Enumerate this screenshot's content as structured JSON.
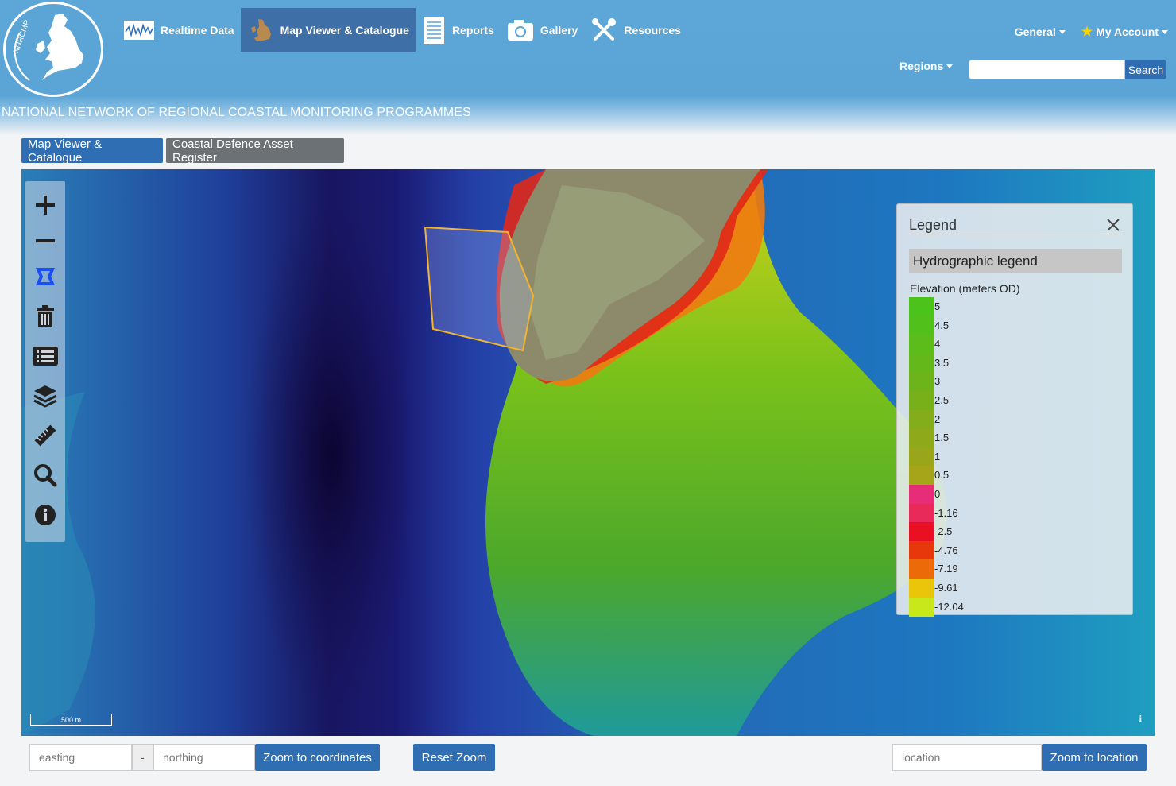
{
  "header": {
    "logo_text": "NNRCMP",
    "nav": [
      {
        "label": "Realtime Data",
        "icon": "waveform-icon"
      },
      {
        "label": "Map Viewer & Catalogue",
        "icon": "uk-map-icon",
        "active": true
      },
      {
        "label": "Reports",
        "icon": "document-icon"
      },
      {
        "label": "Gallery",
        "icon": "camera-icon"
      },
      {
        "label": "Resources",
        "icon": "tools-icon"
      }
    ],
    "general_label": "General",
    "account_label": "My Account",
    "regions_label": "Regions",
    "search_placeholder": "",
    "search_button": "Search",
    "tagline": "NATIONAL NETWORK OF REGIONAL COASTAL MONITORING PROGRAMMES"
  },
  "subtabs": {
    "map_viewer": "Map Viewer & Catalogue",
    "asset_register": "Coastal Defence Asset Register"
  },
  "map": {
    "tools": [
      "zoom-in-icon",
      "zoom-out-icon",
      "draw-polygon-icon",
      "trash-icon",
      "list-icon",
      "layers-icon",
      "ruler-icon",
      "search-zoom-icon",
      "info-icon"
    ],
    "scale_label": "500 m",
    "info_mark": "i"
  },
  "legend": {
    "title": "Legend",
    "subtitle": "Hydrographic legend",
    "units_label": "Elevation (meters OD)",
    "entries": [
      {
        "label": "5",
        "color": "#4cc31a"
      },
      {
        "label": "4.5",
        "color": "#52c01a"
      },
      {
        "label": "4",
        "color": "#5bbc1a"
      },
      {
        "label": "3.5",
        "color": "#64b81a"
      },
      {
        "label": "3",
        "color": "#6db41a"
      },
      {
        "label": "2.5",
        "color": "#78b01a"
      },
      {
        "label": "2",
        "color": "#83ad1a"
      },
      {
        "label": "1.5",
        "color": "#8ea91a"
      },
      {
        "label": "1",
        "color": "#9aa61a"
      },
      {
        "label": "0.5",
        "color": "#a6a51a"
      },
      {
        "label": "0",
        "color": "#e62e78"
      },
      {
        "label": "-1.16",
        "color": "#e82a5a"
      },
      {
        "label": "-2.5",
        "color": "#e81022"
      },
      {
        "label": "-4.76",
        "color": "#e6380a"
      },
      {
        "label": "-7.19",
        "color": "#ec6a08"
      },
      {
        "label": "-9.61",
        "color": "#ebc50a"
      },
      {
        "label": "-12.04",
        "color": "#c8e81c"
      }
    ]
  },
  "controls": {
    "easting_placeholder": "easting",
    "dash": "-",
    "northing_placeholder": "northing",
    "zoom_coords_button": "Zoom to coordinates",
    "reset_zoom_button": "Reset Zoom",
    "location_placeholder": "location",
    "zoom_location_button": "Zoom to location"
  }
}
